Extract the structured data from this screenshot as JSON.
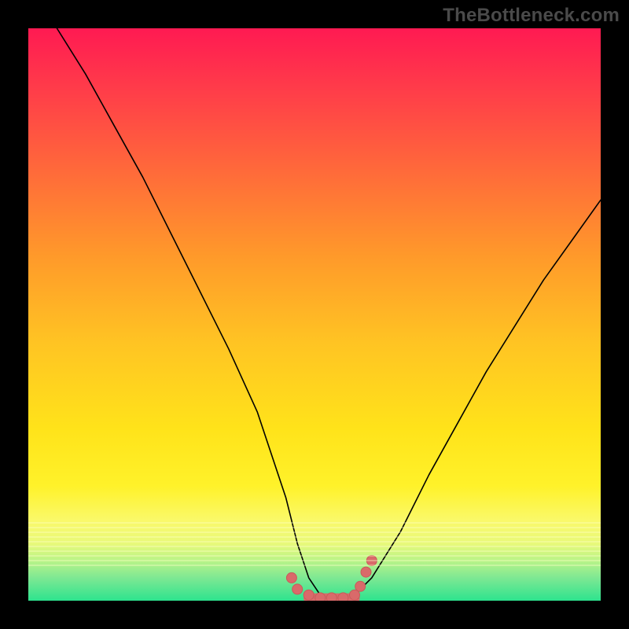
{
  "watermark": "TheBottleneck.com",
  "chart_data": {
    "type": "line",
    "title": "",
    "xlabel": "",
    "ylabel": "",
    "xlim": [
      0,
      100
    ],
    "ylim": [
      0,
      100
    ],
    "series": [
      {
        "name": "bottleneck-curve",
        "x": [
          5,
          10,
          15,
          20,
          25,
          30,
          35,
          40,
          45,
          47,
          49,
          51,
          53,
          55,
          57,
          60,
          65,
          70,
          75,
          80,
          85,
          90,
          95,
          100
        ],
        "values": [
          100,
          92,
          83,
          74,
          64,
          54,
          44,
          33,
          18,
          10,
          4,
          1,
          0,
          0,
          1,
          4,
          12,
          22,
          31,
          40,
          48,
          56,
          63,
          70
        ]
      }
    ],
    "markers": {
      "name": "optimal-range-dots",
      "color": "#d96a6a",
      "points": [
        {
          "x": 46,
          "y": 4
        },
        {
          "x": 47,
          "y": 2
        },
        {
          "x": 49,
          "y": 1
        },
        {
          "x": 51,
          "y": 0.5
        },
        {
          "x": 53,
          "y": 0.5
        },
        {
          "x": 55,
          "y": 0.5
        },
        {
          "x": 57,
          "y": 1
        },
        {
          "x": 58,
          "y": 2.5
        },
        {
          "x": 59,
          "y": 5
        },
        {
          "x": 60,
          "y": 7
        }
      ]
    },
    "colors": {
      "gradient_top": "#ff1a52",
      "gradient_mid": "#ffe31a",
      "gradient_bottom": "#2de38e",
      "line": "#000000",
      "marker": "#d96a6a",
      "frame": "#000000"
    }
  }
}
